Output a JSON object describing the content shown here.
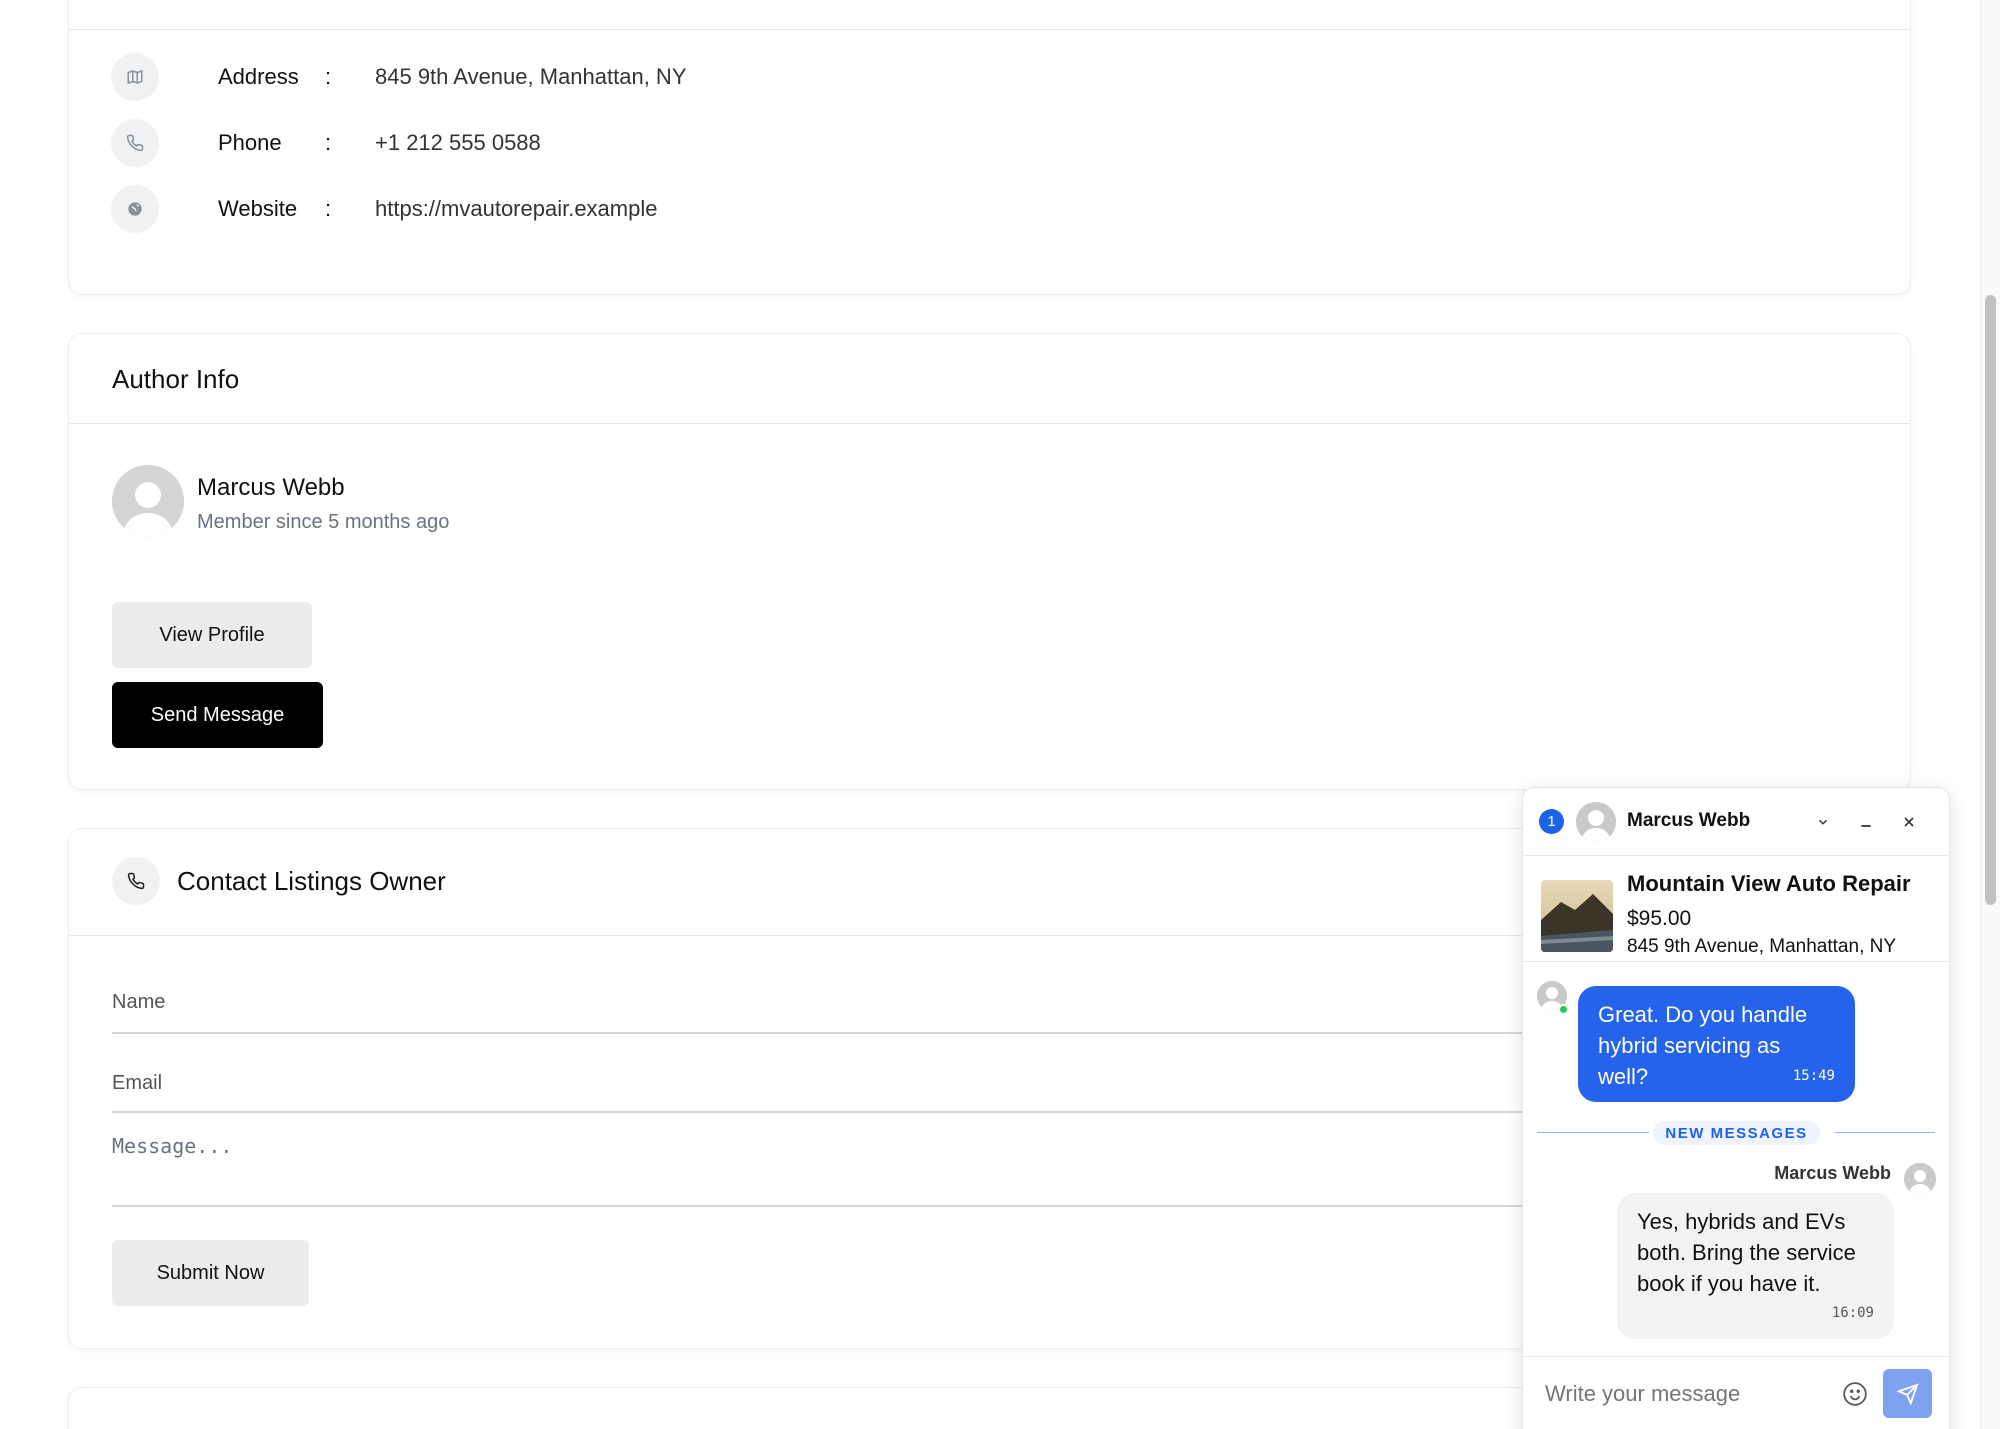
{
  "contact": {
    "rows": [
      {
        "label": "Address",
        "value": "845 9th Avenue, Manhattan, NY",
        "icon": "map-icon"
      },
      {
        "label": "Phone",
        "value": "+1 212 555 0588",
        "icon": "phone-icon"
      },
      {
        "label": "Website",
        "value": "https://mvautorepair.example",
        "icon": "globe-icon"
      }
    ],
    "separator": ":"
  },
  "author": {
    "title": "Author Info",
    "name": "Marcus Webb",
    "since": "Member since 5 months ago",
    "view_profile_label": "View Profile",
    "send_message_label": "Send Message"
  },
  "owner_form": {
    "title": "Contact Listings Owner",
    "name_placeholder": "Name",
    "email_placeholder": "Email",
    "message_placeholder": "Message...",
    "submit_label": "Submit Now"
  },
  "chat": {
    "unread_count": "1",
    "contact_name": "Marcus Webb",
    "listing": {
      "title": "Mountain View Auto Repair",
      "price": "$95.00",
      "address": "845 9th Avenue, Manhattan, NY"
    },
    "messages": [
      {
        "direction": "outgoing",
        "text": "Great. Do you handle hybrid servicing as well?",
        "time": "15:49"
      },
      {
        "direction": "incoming",
        "sender": "Marcus Webb",
        "text": "Yes, hybrids and EVs both. Bring the service book if you have it.",
        "time": "16:09"
      }
    ],
    "new_messages_label": "NEW MESSAGES",
    "input_placeholder": "Write your message"
  },
  "colors": {
    "accent": "#2563eb",
    "primary_button": "#000000",
    "secondary_button": "#ececec",
    "online": "#22c55e"
  }
}
